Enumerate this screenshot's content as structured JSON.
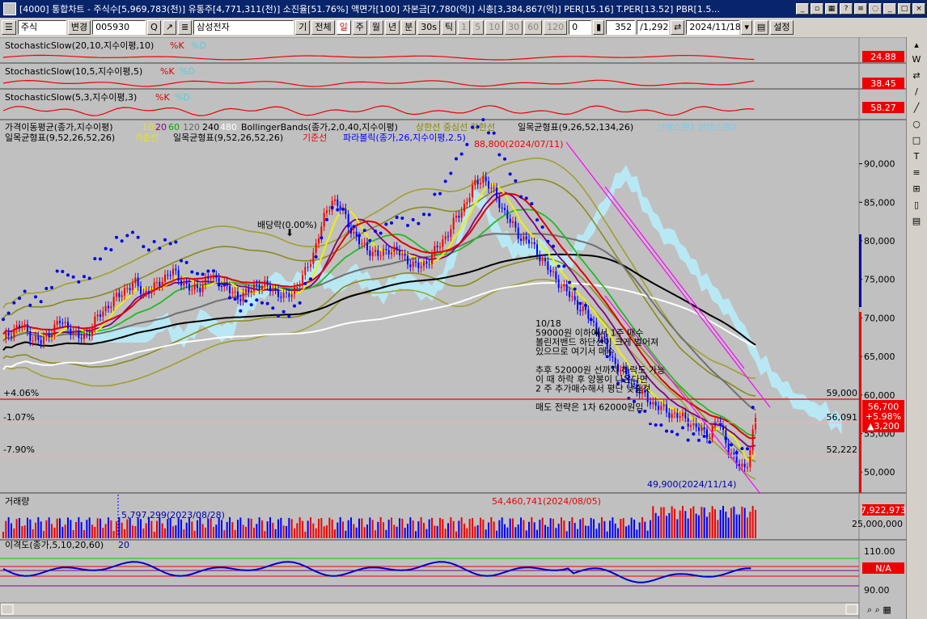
{
  "window": {
    "title": "[4000] 통합차트 - 주식수[5,969,783(천)] 유통주[4,771,311(천)] 소진율[51.76%] 액면가[100] 자본금[7,780(억)] 시총[3,384,867(억)] PER[15.16] T.PER[13.52] PBR[1.5..."
  },
  "toolbar": {
    "market": "주식",
    "change": "변경",
    "code": "005930",
    "name": "삼성전자",
    "periods": [
      "기",
      "전체",
      "일",
      "주",
      "월",
      "년",
      "분",
      "30s",
      "틱"
    ],
    "intervals": [
      "1",
      "5",
      "10",
      "30",
      "60",
      "120"
    ],
    "small_value": "0",
    "count": "352",
    "total": "/1,292",
    "date": "2024/11/18",
    "settings": "설정"
  },
  "panels": {
    "stoch1": {
      "label": "StochasticSlow(20,10,지수이평,10)",
      "k": "%K",
      "d": "%D",
      "value": "24.88"
    },
    "stoch2": {
      "label": "StochasticSlow(10,5,지수이평,5)",
      "k": "%K",
      "d": "%D",
      "value": "38.45"
    },
    "stoch3": {
      "label": "StochasticSlow(5,3,지수이평,3)",
      "k": "%K",
      "d": "%D",
      "value": "58.27"
    },
    "price": {
      "legend1": "가격이동평균(종가,지수이평)",
      "ma_periods": [
        "10",
        "20",
        "60",
        "120",
        "240",
        "480"
      ],
      "bollinger": "BollingerBands(종가,2,0,40,지수이평)",
      "bb_lines": "상한선 중심선 하한선",
      "ichimoku1": "일목균형표(9,26,52,134,26)",
      "ichimoku1_lines": "선행스팬1 선행스팬2",
      "legend2": "일목균형표(9,52,26,52,26)",
      "legend2_line": "기준선",
      "legend3": "일목균형표(9,52,26,52,26)",
      "legend3_line": "기준선",
      "parabolic": "파라볼릭(종가,26,지수이평,2.5)",
      "high_label": "88,800(2024/07/11)",
      "low_label": "49,900(2024/11/14)",
      "dividend": "배당락(0.00%)",
      "pct_plus": "+4.06%",
      "pct_minus1": "-1.07%",
      "pct_minus2": "-7.90%",
      "level_59000": "59,000",
      "level_56091": "56,091",
      "level_52222": "52,222",
      "current_price": "56,700",
      "current_pct": "+5.98%",
      "current_change": "▲3,200",
      "note": [
        "10/18",
        "59000원 이하에서 1주 매수",
        "볼린저밴드 하단선이 크게 벌어져",
        "있으므로 여기서 매수",
        "",
        "추후 52000원 선까지 하락도 가능",
        "이 때 하락 후 양봉이 나온다면",
        "2 주 추가매수해서 평단 낮출것",
        "",
        "매도 전략은 1차 62000원임"
      ]
    },
    "volume": {
      "label": "거래량",
      "high_label": "54,460,741(2024/08/05)",
      "low_label": "5,797,299(2023/08/28)",
      "current": "7,922,973",
      "axis_value": "25,000,000"
    },
    "disparity": {
      "label": "이격도(종가,5,10,20,60)",
      "period": "20",
      "value": "N/A",
      "axis_top": "110.00",
      "axis_bottom": "90.00"
    }
  },
  "chart_data": {
    "type": "candlestick",
    "yticks": [
      "90,000",
      "85,000",
      "80,000",
      "75,000",
      "70,000",
      "65,000",
      "60,000",
      "55,000",
      "50,000"
    ],
    "ylim": [
      47500,
      93000
    ],
    "lines": [
      59000,
      56091,
      52222
    ],
    "close_path": [
      67000,
      68500,
      69000,
      67500,
      66800,
      68200,
      69500,
      68800,
      67300,
      68000,
      70000,
      71500,
      72500,
      73800,
      74500,
      73200,
      73800,
      75200,
      76000,
      74800,
      73500,
      74200,
      75300,
      74800,
      73500,
      72800,
      73200,
      74500,
      74000,
      73500,
      72500,
      73800,
      75500,
      78500,
      82500,
      85500,
      84000,
      81500,
      79500,
      78800,
      78000,
      79000,
      78500,
      77500,
      76500,
      77200,
      78800,
      80500,
      82500,
      84500,
      87000,
      88300,
      86500,
      84500,
      82200,
      80500,
      79800,
      78200,
      76200,
      74800,
      73200,
      71800,
      70500,
      68800,
      66500,
      64200,
      62800,
      61300,
      60000,
      59000,
      58200,
      57600,
      57200,
      56500,
      55500,
      54800,
      56800,
      53500,
      51000,
      50500,
      56700
    ],
    "stoch_series": {
      "k": "red",
      "d": "cyan"
    },
    "axis_right_labels": {
      "stoch1": "24.88",
      "stoch2": "38.45",
      "stoch3": "58.27"
    }
  },
  "sidebar": {
    "items": [
      "W",
      "⇄",
      "/",
      "╱",
      "○",
      "□",
      "T",
      "≡",
      "⊞",
      "▯",
      "▤"
    ]
  }
}
